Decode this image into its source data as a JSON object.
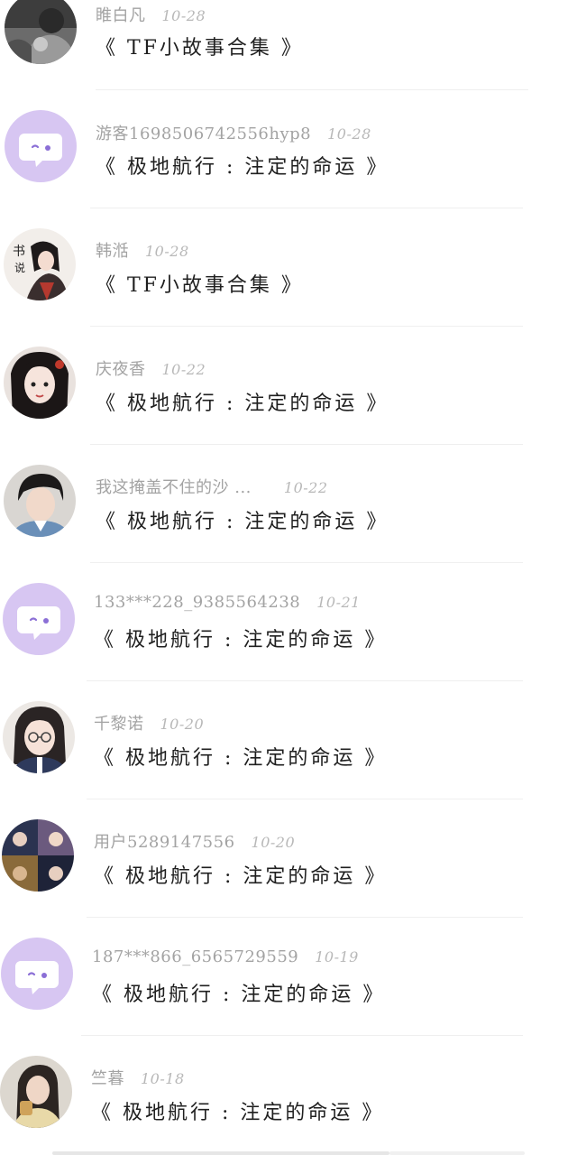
{
  "items": [
    {
      "username": "睢白凡",
      "date": "10-28",
      "title": "《 TF小故事合集 》",
      "avatar": "photo-dark-icon"
    },
    {
      "username": "游客1698506742556hyp8",
      "date": "10-28",
      "title": "《 极地航行 : 注定的命运 》",
      "avatar": "default-chat-avatar-icon"
    },
    {
      "username": "韩湉",
      "date": "10-28",
      "title": "《 TF小故事合集 》",
      "avatar": "illustrated-girl-avatar-icon"
    },
    {
      "username": "庆夜香",
      "date": "10-22",
      "title": "《 极地航行 : 注定的命运 》",
      "avatar": "illustrated-woman-avatar-icon"
    },
    {
      "username": "我这掩盖不住的沙 ...",
      "date": "10-22",
      "title": "《 极地航行 : 注定的命运 》",
      "avatar": "photo-boy-avatar-icon"
    },
    {
      "username": "133***228_9385564238",
      "date": "10-21",
      "title": "《 极地航行 : 注定的命运 》",
      "avatar": "default-chat-avatar-icon"
    },
    {
      "username": "千黎诺",
      "date": "10-20",
      "title": "《 极地航行 : 注定的命运 》",
      "avatar": "illustrated-glasses-girl-avatar-icon"
    },
    {
      "username": "用户5289147556",
      "date": "10-20",
      "title": "《 极地航行 : 注定的命运 》",
      "avatar": "photo-collage-avatar-icon"
    },
    {
      "username": "187***866_6565729559",
      "date": "10-19",
      "title": "《 极地航行 : 注定的命运 》",
      "avatar": "default-chat-avatar-icon"
    },
    {
      "username": "竺暮",
      "date": "10-18",
      "title": "《 极地航行 : 注定的命运 》",
      "avatar": "photo-girl-avatar-icon"
    }
  ],
  "colors": {
    "default_avatar_bg": "#d7c6f2",
    "accent_purple": "#8b6fd6",
    "title_text": "#1f1f1f",
    "meta_text": "#a3a3a3"
  }
}
